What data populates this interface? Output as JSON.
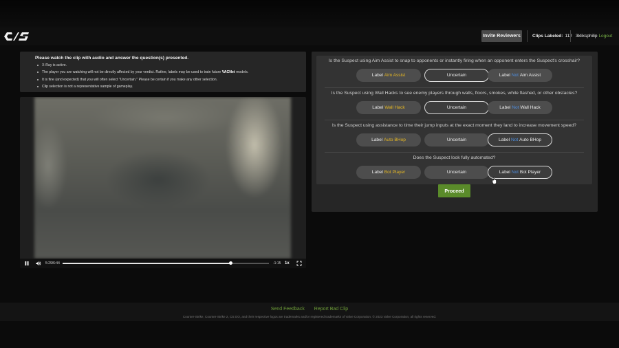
{
  "header": {
    "invite_label": "Invite Reviewers",
    "clips_label": "Clips Labeled:",
    "clips_count": "112",
    "username": "3kliksphilip",
    "logout_label": "Logout"
  },
  "instructions": {
    "heading": "Please watch the clip with audio and answer the question(s) presented.",
    "items": [
      "X-Ray is active.",
      "The player you are watching will not be directly affected by your verdict. Rather, labels may be used to train future ",
      "It is fine (and expected) that you will often select \"Uncertain.\" Please be certain if you make any other selection.",
      "Clip selection is not a representative sample of gameplay."
    ],
    "item2_bold": "VACNet",
    "item2_tail": " models."
  },
  "player": {
    "time": "5:29/6:44",
    "remaining": "-1:15",
    "speed": "1x",
    "progress": 0.815
  },
  "questions": [
    {
      "text": "Is the Suspect using Aim Assist to snap to opponents or instantly firing when an opponent enters the Suspect's crosshair?",
      "label_prefix": "Label ",
      "feature": "Aim Assist",
      "uncertain": "Uncertain",
      "not_word": "Not",
      "selected": "uncertain"
    },
    {
      "text": "Is the Suspect using Wall Hacks to see enemy players through walls, floors, smokes, while flashed, or other obstacles?",
      "label_prefix": "Label ",
      "feature": "Wall Hack",
      "uncertain": "Uncertain",
      "not_word": "Not",
      "selected": "uncertain"
    },
    {
      "text": "Is the Suspect using assistance to time their jump inputs at the exact moment they land to increase movement speed?",
      "label_prefix": "Label ",
      "feature": "Auto BHop",
      "uncertain": "Uncertain",
      "not_word": "Not",
      "selected": "not"
    },
    {
      "text": "Does the Suspect look fully automated?",
      "label_prefix": "Label ",
      "feature": "Bot Player",
      "uncertain": "Uncertain",
      "not_word": "Not",
      "selected": "not"
    }
  ],
  "proceed_label": "Proceed",
  "footer": {
    "send_feedback": "Send Feedback",
    "report_bad_clip": "Report Bad Clip",
    "copyright": "Counter-Strike, Counter-Strike 2, CS:GO, and their respective logos are trademarks and/or registered trademarks of Valve Corporation. © 2023 Valve Corporation, all rights reserved."
  },
  "colors": {
    "accent_green": "#5a8b2a",
    "label_yellow": "#e8b923",
    "label_blue": "#4f8fe0"
  },
  "icons": {
    "logo": "cs2-logo",
    "pause": "pause-icon",
    "volume": "volume-icon",
    "fullscreen": "fullscreen-icon",
    "cursor": "mouse-pointer-icon"
  }
}
